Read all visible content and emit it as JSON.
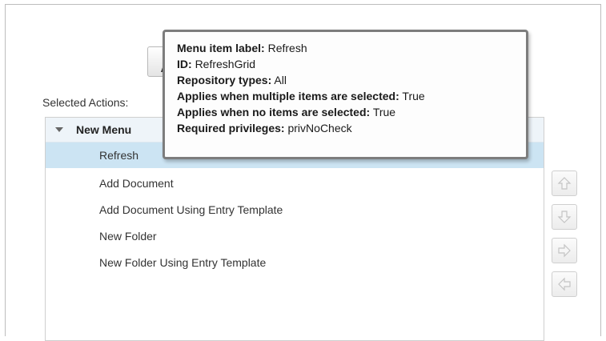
{
  "selected_actions_label": "Selected Actions:",
  "behind_button_stub": "A",
  "tree": {
    "root": "New Menu",
    "items": [
      {
        "label": "Refresh",
        "selected": true
      },
      {
        "label": "Add Document",
        "selected": false
      },
      {
        "label": "Add Document Using Entry Template",
        "selected": false
      },
      {
        "label": "New Folder",
        "selected": false
      },
      {
        "label": "New Folder Using Entry Template",
        "selected": false
      }
    ]
  },
  "side_buttons": [
    {
      "name": "move-up-button",
      "icon": "arrow-up-icon"
    },
    {
      "name": "move-down-button",
      "icon": "arrow-down-icon"
    },
    {
      "name": "move-right-button",
      "icon": "arrow-right-icon"
    },
    {
      "name": "move-left-button",
      "icon": "arrow-left-icon"
    }
  ],
  "tooltip": {
    "rows": [
      {
        "key": "Menu item label:",
        "value": "Refresh"
      },
      {
        "key": "ID:",
        "value": "RefreshGrid"
      },
      {
        "key": "Repository types:",
        "value": "All"
      },
      {
        "key": "Applies when multiple items are selected:",
        "value": "True"
      },
      {
        "key": "Applies when no items are selected:",
        "value": "True"
      },
      {
        "key": "Required privileges:",
        "value": "privNoCheck"
      }
    ]
  },
  "colors": {
    "selected_row": "#cce4f3",
    "tree_header": "#eef4f9",
    "tooltip_border": "#7d7d7d",
    "arrow_icon": "#c9c9c9"
  }
}
